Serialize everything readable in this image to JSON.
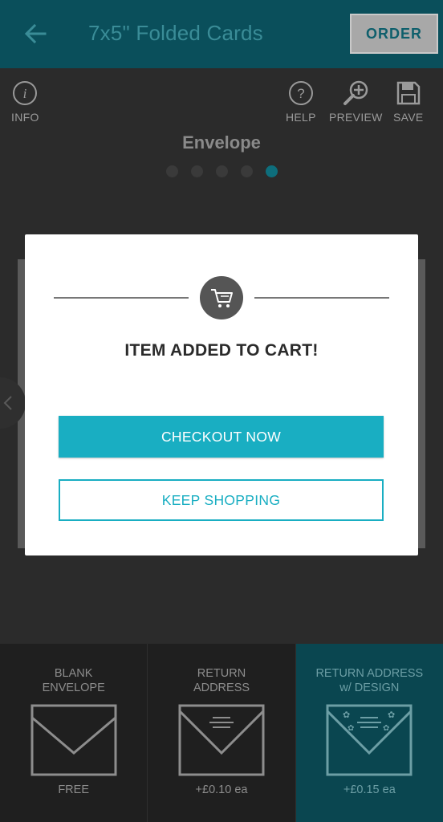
{
  "header": {
    "title": "7x5\" Folded Cards",
    "order_label": "ORDER"
  },
  "toolbar": {
    "info_label": "INFO",
    "help_label": "HELP",
    "preview_label": "PREVIEW",
    "save_label": "SAVE"
  },
  "step": {
    "title": "Envelope",
    "total_steps": 5,
    "active_step": 5
  },
  "options": [
    {
      "title_line1": "BLANK",
      "title_line2": "ENVELOPE",
      "price": "FREE",
      "selected": false,
      "icon": "blank-envelope-icon"
    },
    {
      "title_line1": "RETURN",
      "title_line2": "ADDRESS",
      "price": "+£0.10 ea",
      "selected": false,
      "icon": "return-address-envelope-icon"
    },
    {
      "title_line1": "RETURN ADDRESS",
      "title_line2": "w/ DESIGN",
      "price": "+£0.15 ea",
      "selected": true,
      "icon": "design-envelope-icon"
    }
  ],
  "modal": {
    "title": "ITEM ADDED TO CART!",
    "primary_label": "CHECKOUT NOW",
    "secondary_label": "KEEP SHOPPING",
    "icon": "cart-icon"
  },
  "colors": {
    "accent": "#19aec2",
    "header_bg": "#0a4f5b",
    "selected_option_bg": "#0a4650"
  }
}
